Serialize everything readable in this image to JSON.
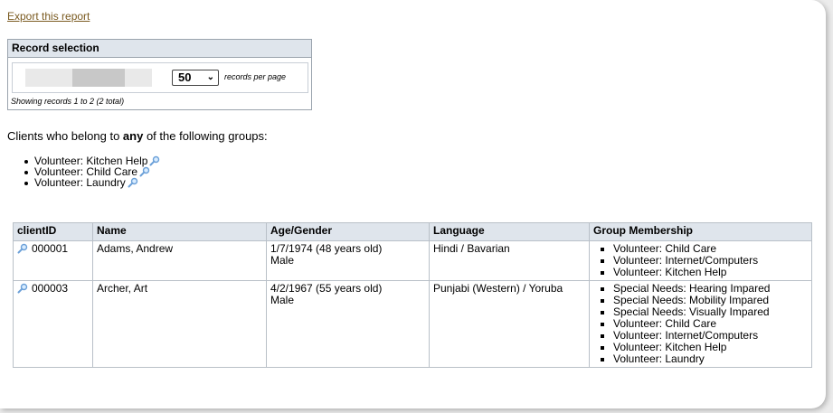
{
  "export_link": "Export this report",
  "record_selection": {
    "title": "Record selection",
    "per_page_value": "50",
    "per_page_label": "records per page",
    "showing": "Showing records 1 to 2 (2 total)"
  },
  "intro": {
    "prefix": "Clients who belong to ",
    "emphasis": "any",
    "suffix": " of the following groups:"
  },
  "groups": [
    "Volunteer: Kitchen Help",
    "Volunteer: Child Care",
    "Volunteer: Laundry"
  ],
  "table": {
    "headers": [
      "clientID",
      "Name",
      "Age/Gender",
      "Language",
      "Group Membership"
    ],
    "rows": [
      {
        "id": "000001",
        "name": "Adams, Andrew",
        "age": "1/7/1974 (48 years old)",
        "gender": "Male",
        "language": "Hindi / Bavarian",
        "groups": [
          "Volunteer: Child Care",
          "Volunteer: Internet/Computers",
          "Volunteer: Kitchen Help"
        ]
      },
      {
        "id": "000003",
        "name": "Archer, Art",
        "age": "4/2/1967 (55 years old)",
        "gender": "Male",
        "language": "Punjabi (Western) / Yoruba",
        "groups": [
          "Special Needs: Hearing Impared",
          "Special Needs: Mobility Impared",
          "Special Needs: Visually Impared",
          "Volunteer: Child Care",
          "Volunteer: Internet/Computers",
          "Volunteer: Kitchen Help",
          "Volunteer: Laundry"
        ]
      }
    ]
  },
  "colors": {
    "link": "#7a5a20",
    "header_bg": "#dfe5ec",
    "magnifier": "#6ba0d8"
  },
  "icons": {
    "magnifier": "magnifier-icon"
  }
}
